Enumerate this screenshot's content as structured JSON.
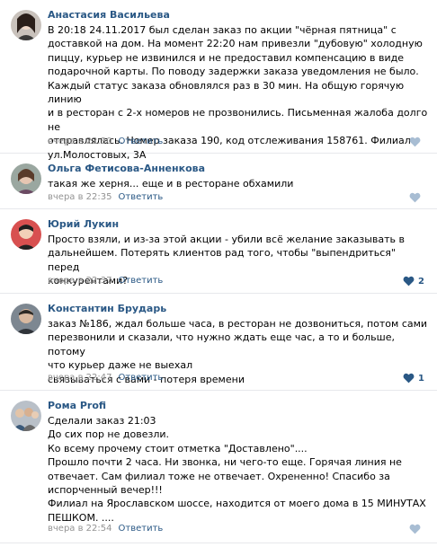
{
  "comments": [
    {
      "author": "Анастасия Васильева",
      "text": "В 20:18 24.11.2017 был сделан заказ по акции \"чёрная пятница\" с\nдоставкой на дом. На момент 22:20 нам привезли \"дубовую\" холодную\nпиццу, курьер не извинился и не предоставил компенсацию в виде\nподарочной карты. По поводу задержки заказа уведомления не было.\nКаждый статус заказа обновлялся раз в 30 мин. На общую горячую линию\nи в ресторан с 2-х номеров не прозвонились. Письменная жалоба долго не\nотправлялась. Номер заказа 190, код отслеживания 158761. Филиал\nул.Молостовых, 3А",
      "time": "вчера в 22:30",
      "reply_label": "Ответить",
      "likes": ""
    },
    {
      "author": "Ольга Фетисова-Анненкова",
      "text": "такая же херня... еще и в ресторане обхамили",
      "time": "вчера в 22:35",
      "reply_label": "Ответить",
      "likes": ""
    },
    {
      "author": "Юрий Лукин",
      "text": "Просто взяли, и из-за этой акции - убили всё желание заказывать в\nдальнейшем. Потерять клиентов рад того, чтобы \"выпендриться\" перед\nконкурентами?",
      "time": "вчера в 22:37",
      "reply_label": "Ответить",
      "likes": "2"
    },
    {
      "author": "Константин Брударь",
      "text": "заказ №186, ждал больше часа, в ресторан не дозвониться, потом сами\nперезвонили и сказали, что нужно ждать еще час, а то и больше, потому\nчто курьер даже не выехал\nсвязываться с вами - потеря времени",
      "time": "вчера в 22:47",
      "reply_label": "Ответить",
      "likes": "1"
    },
    {
      "author": "Рома Profi",
      "text": "Сделали заказ 21:03\nДо сих пор не довезли.\nКо всему прочему стоит отметка \"Доставлено\"....\nПрошло почти 2 часа. Ни звонка, ни чего-то еще. Горячая линия не\nотвечает. Сам филиал тоже не отвечает. Охрененно! Спасибо за\nиспорченный вечер!!!\nФилиал на Ярославском шоссе, находится от моего дома в 15 МИНУТАХ\nПЕШКОМ. ....",
      "time": "вчера в 22:54",
      "reply_label": "Ответить",
      "likes": ""
    }
  ],
  "icons": {
    "like": "heart-icon"
  },
  "colors": {
    "link": "#2a5885",
    "meta": "#939393",
    "like": "#2a5885",
    "like_empty": "#a8bdd3",
    "divider": "#e7e8ec"
  }
}
